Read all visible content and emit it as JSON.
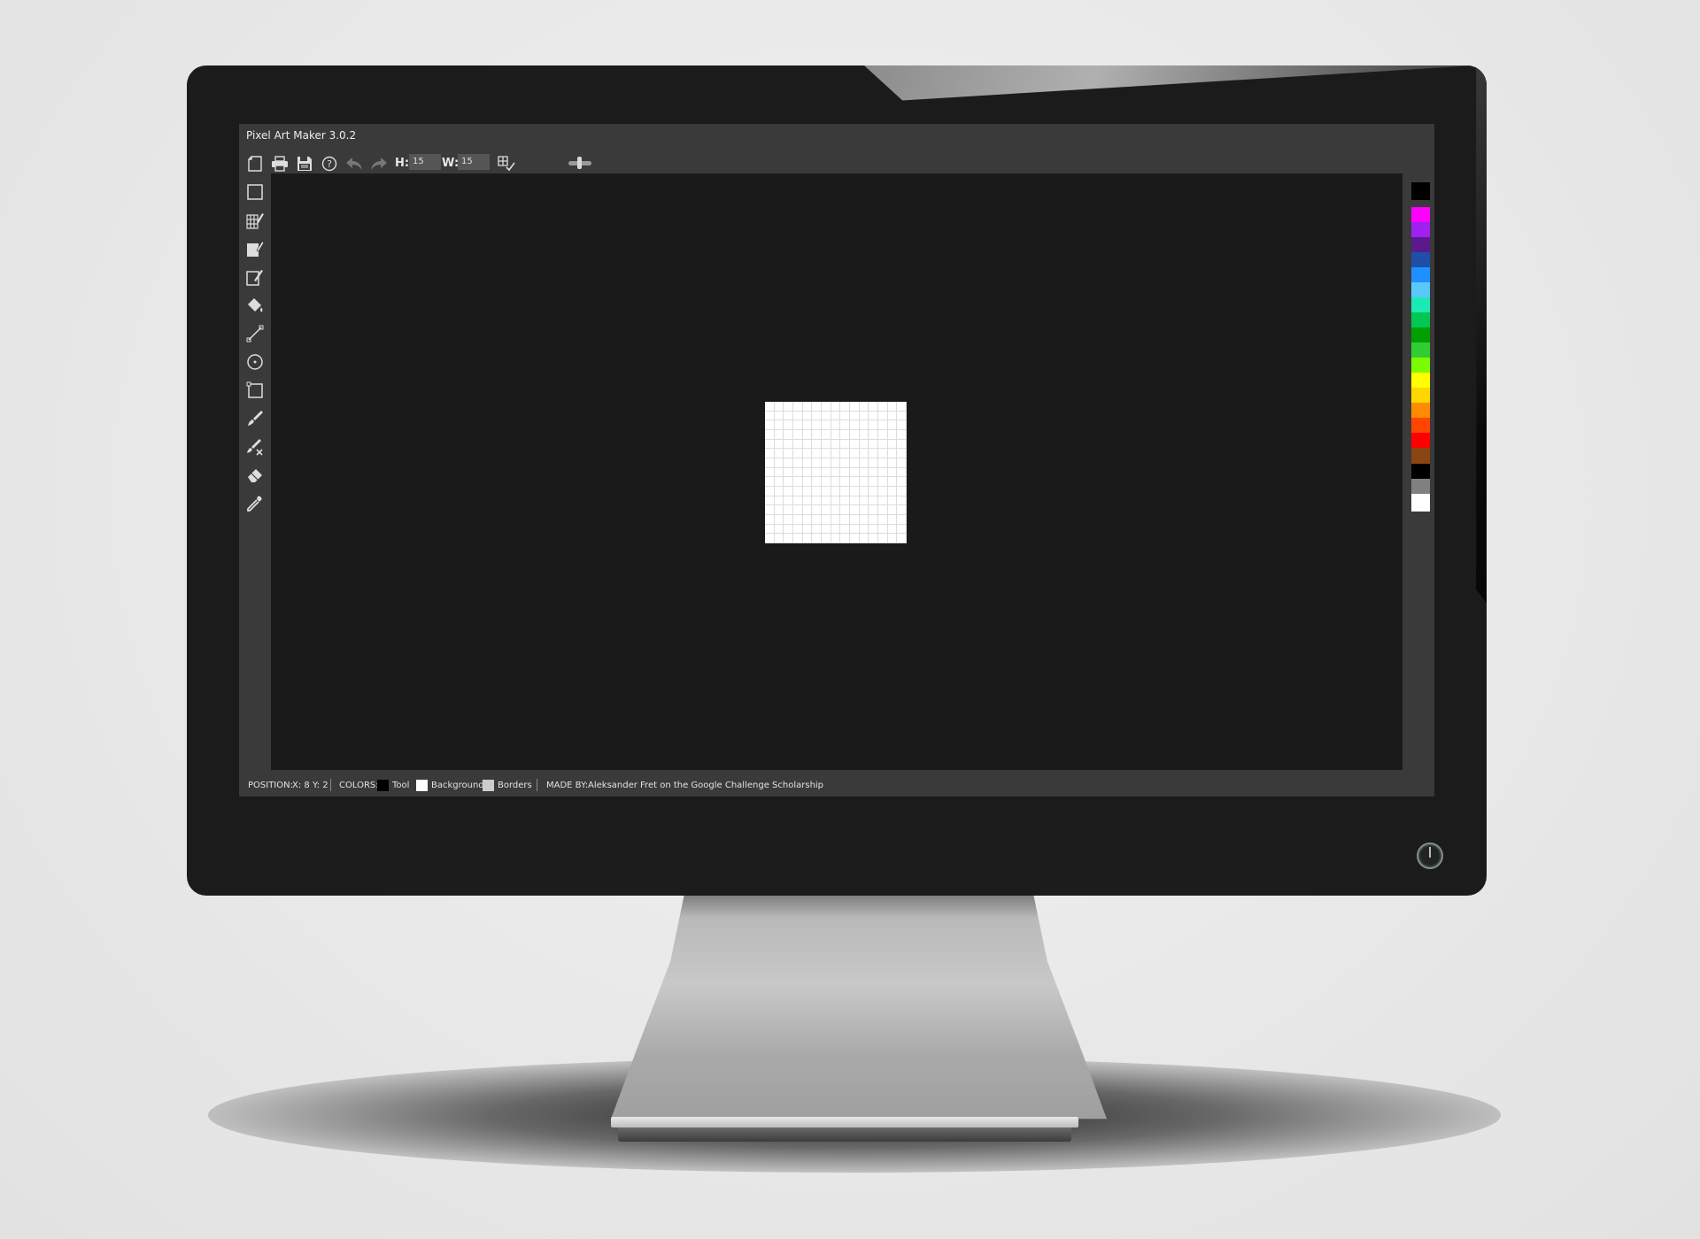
{
  "app": {
    "title": "Pixel Art Maker 3.0.2"
  },
  "toolbar": {
    "height_label": "H:",
    "height_value": "15",
    "width_label": "W:",
    "width_value": "15",
    "buttons": [
      "new-canvas-icon",
      "print-icon",
      "save-icon",
      "help-icon",
      "undo-icon",
      "redo-icon",
      "grid-toggle-icon"
    ]
  },
  "tools": [
    "select-icon",
    "grid-brush-icon",
    "fill-brush-icon",
    "brush-outline-icon",
    "paint-bucket-icon",
    "line-icon",
    "circle-icon",
    "rectangle-icon",
    "pencil-icon",
    "pencil-erase-icon",
    "eraser-icon",
    "eyedropper-icon"
  ],
  "palette": {
    "colors": [
      "#000000",
      "#ff00ff",
      "#a020f0",
      "#5a1a8c",
      "#1f4fa8",
      "#1e90ff",
      "#5ac8fa",
      "#1de9b6",
      "#00c853",
      "#00a000",
      "#32cd32",
      "#7cfc00",
      "#ffff00",
      "#ffd700",
      "#ff8c00",
      "#ff4500",
      "#ff0000",
      "#8b4513",
      "#000000",
      "#808080",
      "#ffffff"
    ]
  },
  "canvas": {
    "rows": 15,
    "cols": 15
  },
  "status": {
    "position_label": "POSITION:",
    "position_value": "X: 8 Y: 2",
    "colors_label": "COLORS:",
    "tool_label": "Tool",
    "tool_color": "#000000",
    "background_label": "Background",
    "background_color": "#ffffff",
    "borders_label": "Borders",
    "borders_color": "#cccccc",
    "made_by_label": "MADE BY:",
    "made_by_value": "Aleksander Fret on the Google Challenge Scholarship"
  }
}
